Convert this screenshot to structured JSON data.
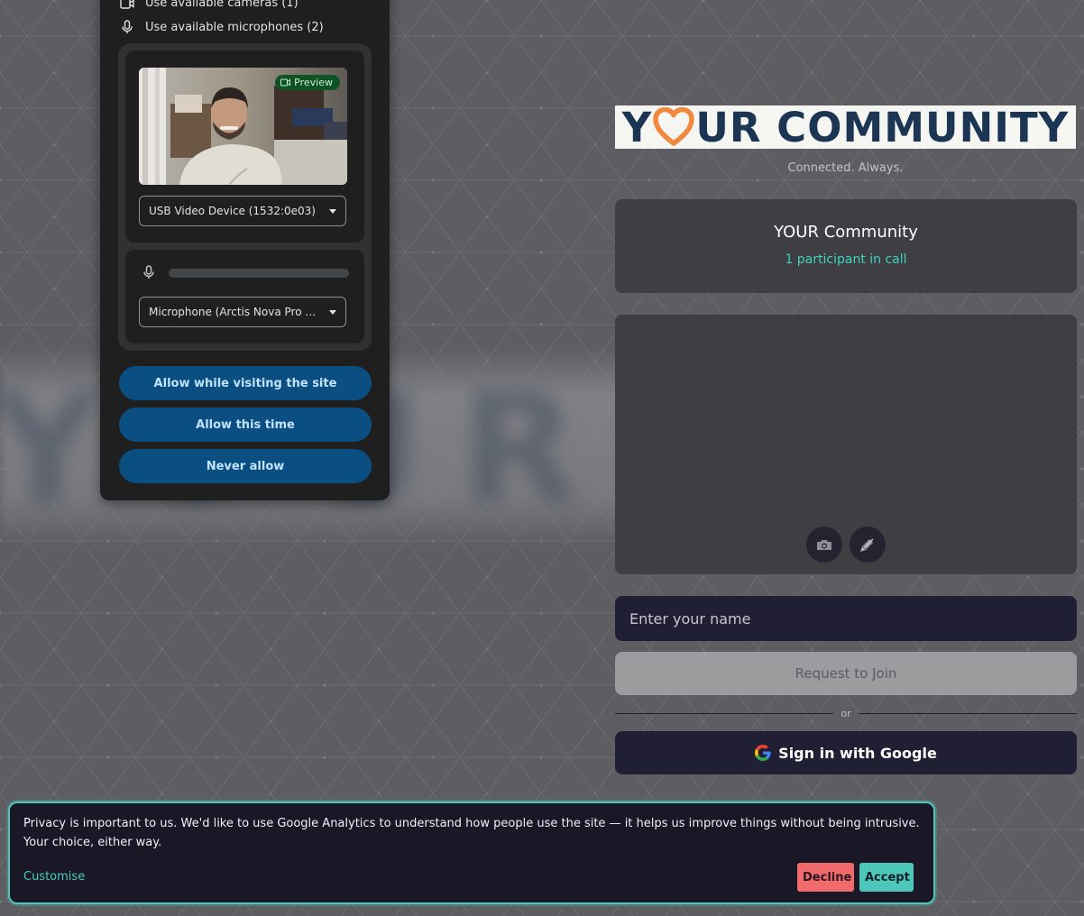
{
  "permission_prompt": {
    "cameras_label": "Use available cameras (1)",
    "microphones_label": "Use available microphones (2)",
    "preview_badge": "Preview",
    "camera_select": "USB Video Device (1532:0e03)",
    "microphone_select": "Microphone (Arctis Nova Pro Wir...",
    "buttons": {
      "allow_visiting": "Allow while visiting the site",
      "allow_once": "Allow this time",
      "never": "Never allow"
    }
  },
  "brand": {
    "logo_text_before": "Y",
    "logo_text_after": "UR COMMUNITY",
    "tagline": "Connected. Always."
  },
  "call_info": {
    "title": "YOUR Community",
    "participants": "1 participant in call"
  },
  "join_form": {
    "name_placeholder": "Enter your name",
    "request_label": "Request to Join",
    "or_label": "or",
    "google_label": "Sign in with Google"
  },
  "cookie_banner": {
    "message": "Privacy is important to us. We'd like to use Google Analytics to understand how people use the site — it helps us improve things without being intrusive. Your choice, either way.",
    "customise_label": "Customise",
    "decline_label": "Decline",
    "accept_label": "Accept"
  },
  "colors": {
    "accent_teal": "#4ec7bb",
    "decline_red": "#f06a6c",
    "chrome_button_blue": "#0b4f82",
    "logo_navy": "#1b3553",
    "logo_heart_orange": "#f0883e"
  }
}
